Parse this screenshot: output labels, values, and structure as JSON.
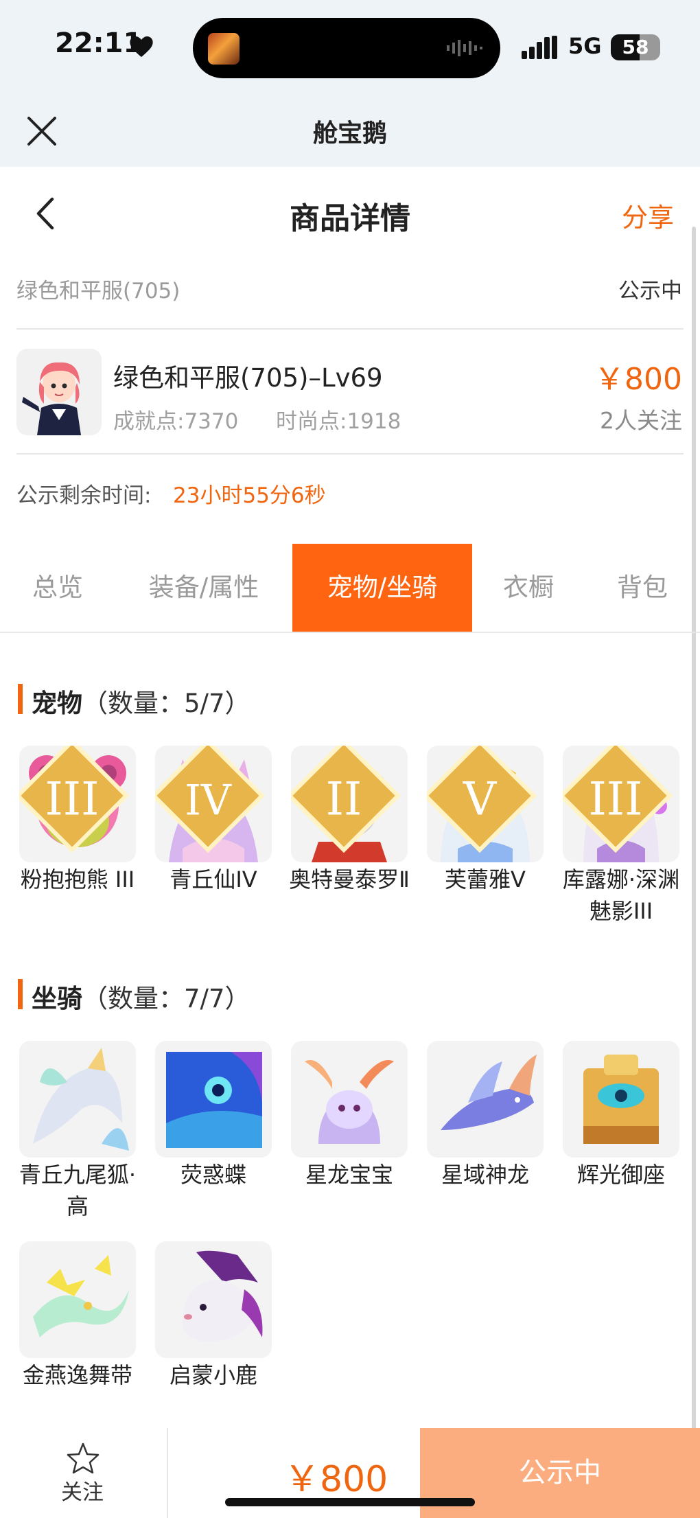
{
  "status_bar": {
    "time": "22:11",
    "network": "5G",
    "battery": "58",
    "battery_level": 0.58
  },
  "app_bar": {
    "title": "舱宝鹅"
  },
  "header": {
    "title": "商品详情",
    "share_label": "分享"
  },
  "listing": {
    "subtitle": "绿色和平服(705)",
    "status": "公示中",
    "name": "绿色和平服(705)–Lv69",
    "achievement_points": "成就点:7370",
    "fashion_points": "时尚点:1918",
    "price": "￥800",
    "followers": "2人关注",
    "timer_label": "公示剩余时间:",
    "timer_value": "23小时55分6秒"
  },
  "tabs": [
    "总览",
    "装备/属性",
    "宠物/坐骑",
    "衣橱",
    "背包"
  ],
  "active_tab": 2,
  "pets": {
    "title": "宠物",
    "count": "（数量：5/7）",
    "items": [
      {
        "name": "粉抱抱熊 III",
        "rank": "III"
      },
      {
        "name": "青丘仙IV",
        "rank": "IV"
      },
      {
        "name": "奥特曼泰罗Ⅱ",
        "rank": "II"
      },
      {
        "name": "芙蕾雅V",
        "rank": "V"
      },
      {
        "name": "库露娜·深渊魅影III",
        "rank": "III"
      }
    ]
  },
  "mounts": {
    "title": "坐骑",
    "count": "（数量：7/7）",
    "items": [
      {
        "name": "青丘九尾狐·高"
      },
      {
        "name": "荧惑蝶"
      },
      {
        "name": "星龙宝宝"
      },
      {
        "name": "星域神龙"
      },
      {
        "name": "辉光御座"
      },
      {
        "name": "金燕逸舞带"
      },
      {
        "name": "启蒙小鹿"
      }
    ]
  },
  "bottom_bar": {
    "follow_label": "关注",
    "price": "￥800",
    "action_label": "公示中"
  },
  "colors": {
    "accent": "#f0650f",
    "tab_active": "#ff6410",
    "action_button": "#fbad7f"
  }
}
